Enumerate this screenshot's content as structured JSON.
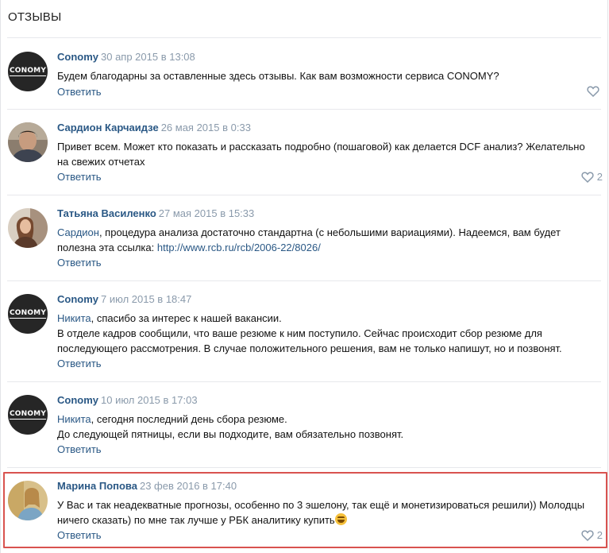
{
  "topic": {
    "title": "ОТЗЫВЫ"
  },
  "comments": [
    {
      "author": "Conomy",
      "date": "30 апр 2015 в 13:08",
      "avatar_text": "CONOMY",
      "avatar_type": "conomy",
      "lines": [
        "Будем благодарны за оставленные здесь отзывы. Как вам возможности сервиса CONOMY?"
      ],
      "reply_label": "Ответить",
      "likes": ""
    },
    {
      "author": "Сардион Карчаидзе",
      "date": "26 мая 2015 в 0:33",
      "avatar_type": "photo-man",
      "lines": [
        "Привет всем. Может кто показать и рассказать подробно (пошаговой) как делается DCF анализ? Желательно",
        "на свежих отчетах"
      ],
      "reply_label": "Ответить",
      "likes": "2"
    },
    {
      "author": "Татьяна Василенко",
      "date": "27 мая 2015 в 15:33",
      "avatar_type": "photo-woman",
      "mention": "Сардион",
      "line1_rest": ", процедура анализа достаточно стандартна (с небольшими вариациями). Надеемся, вам будет",
      "line2_prefix": "полезна эта ссылка: ",
      "link": "http://www.rcb.ru/rcb/2006-22/8026/",
      "reply_label": "Ответить",
      "likes": ""
    },
    {
      "author": "Conomy",
      "date": "7 июл 2015 в 18:47",
      "avatar_text": "CONOMY",
      "avatar_type": "conomy",
      "mention": "Никита",
      "line1_rest": ", спасибо за интерес к нашей вакансии.",
      "lines": [
        "В отделе кадров сообщили, что ваше резюме к ним поступило. Сейчас происходит сбор резюме для",
        "последующего рассмотрения. В случае положительного решения, вам не только напишут, но и позвонят."
      ],
      "reply_label": "Ответить",
      "likes": ""
    },
    {
      "author": "Conomy",
      "date": "10 июл 2015 в 17:03",
      "avatar_text": "CONOMY",
      "avatar_type": "conomy",
      "mention": "Никита",
      "line1_rest": ", сегодня последний день сбора резюме.",
      "lines": [
        "До следующей пятницы, если вы подходите, вам обязательно позвонят."
      ],
      "reply_label": "Ответить",
      "likes": ""
    },
    {
      "author": "Марина Попова",
      "date": "23 фев 2016 в 17:40",
      "avatar_type": "photo-woman2",
      "lines": [
        "У Вас и так неадекватные прогнозы, особенно по 3 эшелону, так ещё и монетизироваться решили)) Молодцы",
        "ничего сказать) по мне так лучше у РБК аналитику купить"
      ],
      "emoji": "laughing-emoji",
      "reply_label": "Ответить",
      "likes": "2"
    }
  ],
  "colors": {
    "link": "#2a5885",
    "date": "#8a9aab",
    "highlight": "#d9534f"
  }
}
